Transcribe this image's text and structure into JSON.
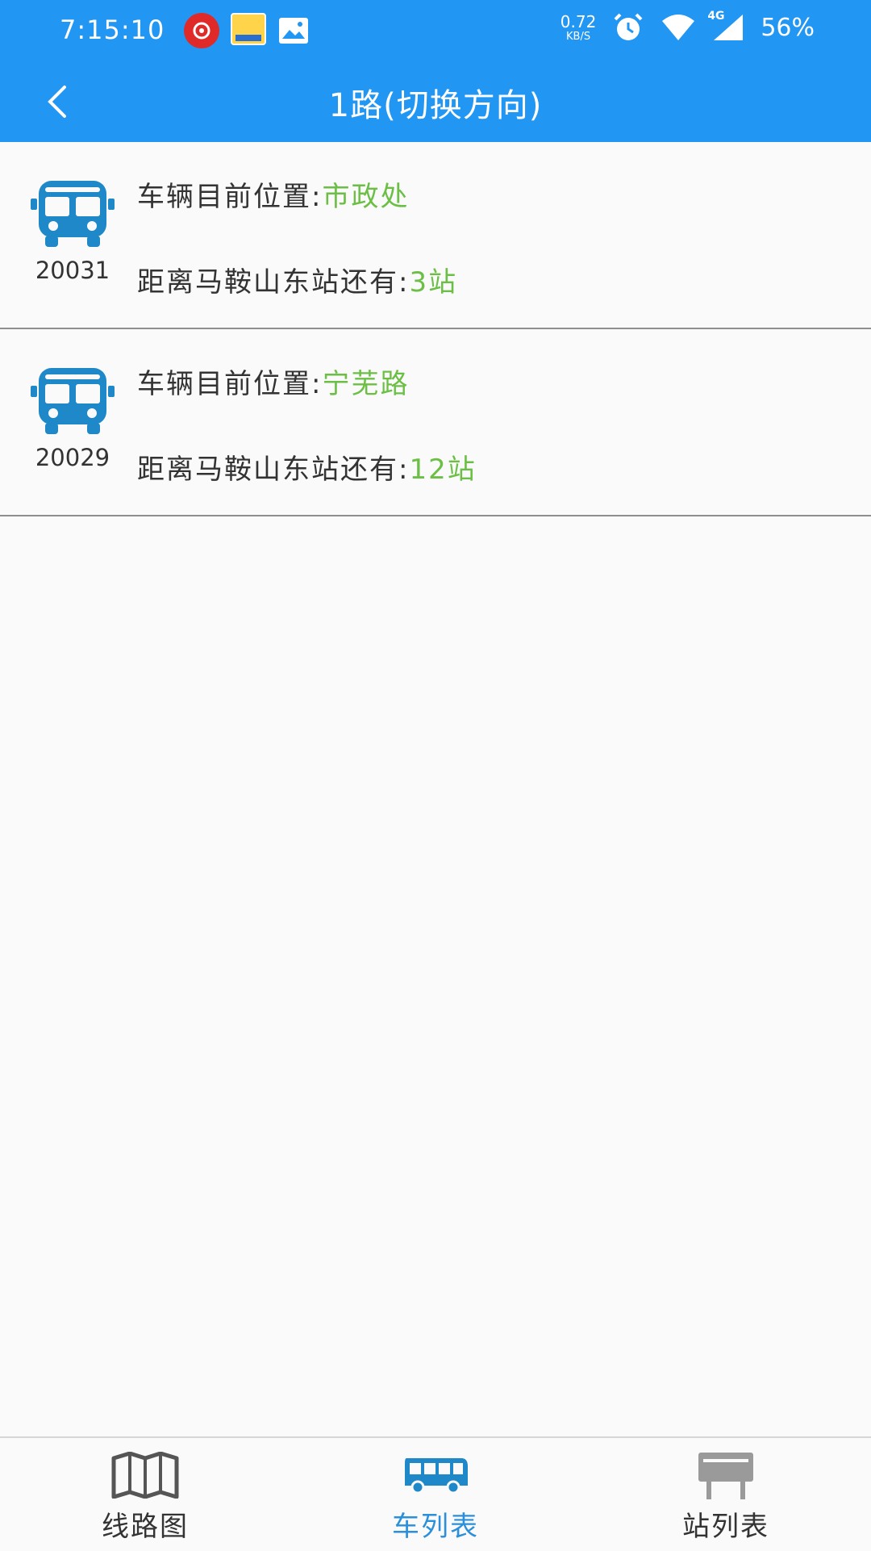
{
  "status_bar": {
    "time": "7:15:10",
    "net_speed_value": "0.72",
    "net_speed_unit": "KB/S",
    "network_type": "4G",
    "battery": "56%",
    "icons": [
      "netease-music-icon",
      "app-thumbnail-icon",
      "gallery-icon",
      "alarm-icon",
      "wifi-icon",
      "cellular-signal-icon"
    ]
  },
  "app_bar": {
    "title": "1路(切换方向)",
    "back_icon": "chevron-left-icon"
  },
  "buses": [
    {
      "id": "20031",
      "position_label": "车辆目前位置:",
      "position_value": "市政处",
      "distance_label": "距离马鞍山东站还有:",
      "distance_value": "3站"
    },
    {
      "id": "20029",
      "position_label": "车辆目前位置:",
      "position_value": "宁芜路",
      "distance_label": "距离马鞍山东站还有:",
      "distance_value": "12站"
    }
  ],
  "bottom_nav": {
    "items": [
      {
        "label": "线路图",
        "icon": "map-icon",
        "active": false
      },
      {
        "label": "车列表",
        "icon": "bus-icon",
        "active": true
      },
      {
        "label": "站列表",
        "icon": "station-sign-icon",
        "active": false
      }
    ]
  },
  "colors": {
    "primary": "#2196f3",
    "bus_icon": "#1e88c8",
    "highlight_value": "#6cbf45",
    "active_nav": "#2b8fd9",
    "inactive_nav_icon": "#555555"
  }
}
